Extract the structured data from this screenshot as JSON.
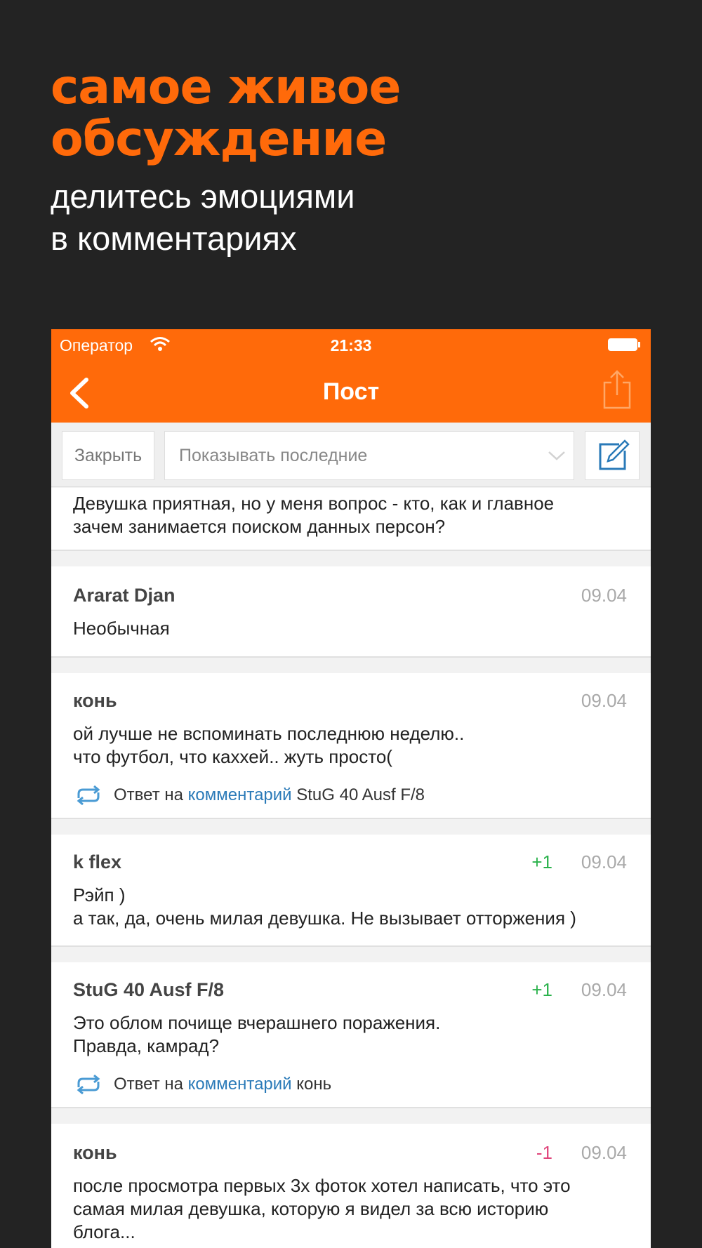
{
  "promo": {
    "title_line1": "самое живое",
    "title_line2": "обсуждение",
    "subtitle_line1": "делитесь эмоциями",
    "subtitle_line2": "в комментариях"
  },
  "status_bar": {
    "carrier": "Оператор",
    "time": "21:33"
  },
  "nav": {
    "title": "Пост"
  },
  "filter": {
    "close_label": "Закрыть",
    "sort_value": "Показывать последние"
  },
  "colors": {
    "accent": "#ff6a0a",
    "background": "#232323",
    "link": "#2a7ab8",
    "positive": "#2bb24c",
    "negative": "#e0457b"
  },
  "icons": [
    "wifi-icon",
    "battery-icon",
    "back-icon",
    "share-icon",
    "chevron-down-icon",
    "compose-icon",
    "reply-icon"
  ],
  "comments": [
    {
      "text_lines": [
        "Девушка приятная, но у меня вопрос - кто, как и главное",
        "зачем занимается поиском данных персон?"
      ]
    },
    {
      "author": "Ararat Djan",
      "date": "09.04",
      "text_lines": [
        "Необычная"
      ]
    },
    {
      "author": "конь",
      "date": "09.04",
      "text_lines": [
        "ой лучше не вспоминать последнюю неделю..",
        "что футбол, что каххей.. жуть просто("
      ],
      "reply": {
        "prefix": "Ответ на",
        "link": "комментарий",
        "target": "StuG 40 Ausf F/8"
      }
    },
    {
      "author": "k flex",
      "score": "+1",
      "date": "09.04",
      "text_lines": [
        "Рэйп )",
        "а так, да, очень милая девушка. Не вызывает отторжения )"
      ]
    },
    {
      "author": "StuG 40 Ausf F/8",
      "score": "+1",
      "date": "09.04",
      "text_lines": [
        "Это облом почище вчерашнего поражения.",
        "Правда, камрад?"
      ],
      "reply": {
        "prefix": "Ответ на",
        "link": "комментарий",
        "target": "конь"
      }
    },
    {
      "author": "конь",
      "score": "-1",
      "date": "09.04",
      "text_lines": [
        "после просмотра первых 3х фоток хотел написать, что это",
        "самая милая девушка, которую я видел за всю историю",
        "блога..."
      ]
    }
  ]
}
